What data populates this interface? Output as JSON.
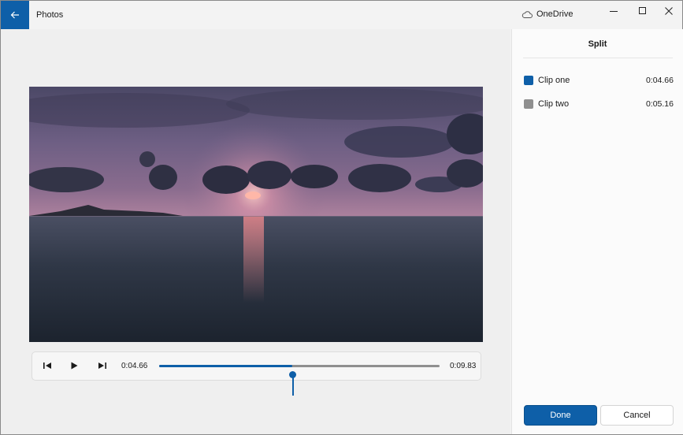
{
  "app": {
    "title": "Photos",
    "cloud_label": "OneDrive"
  },
  "player": {
    "current_time": "0:04.66",
    "total_time": "0:09.83",
    "progress": 0.474
  },
  "panel": {
    "title": "Split",
    "clips": [
      {
        "label": "Clip one",
        "time": "0:04.66",
        "color": "#0e5fa8"
      },
      {
        "label": "Clip two",
        "time": "0:05.16",
        "color": "#8f8f8f"
      }
    ],
    "done_label": "Done",
    "cancel_label": "Cancel"
  },
  "colors": {
    "accent": "#0e5fa8",
    "track": "#8f8f8f"
  },
  "icons": [
    "back-arrow-icon",
    "cloud-icon",
    "minimize-icon",
    "maximize-icon",
    "close-icon",
    "previous-frame-icon",
    "play-icon",
    "next-frame-icon"
  ]
}
